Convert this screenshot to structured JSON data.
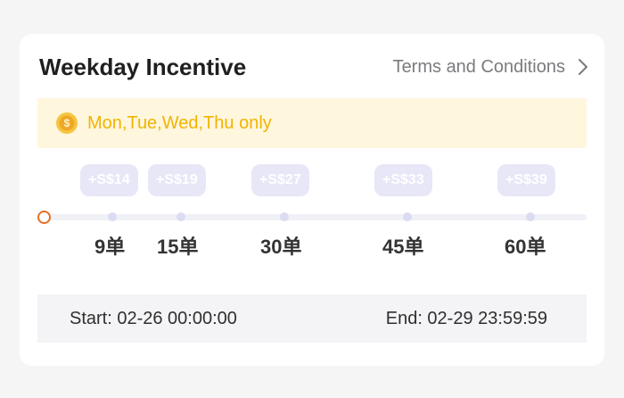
{
  "header": {
    "title": "Weekday Incentive",
    "terms_label": "Terms and Conditions",
    "icon": "chevron-right-icon"
  },
  "banner": {
    "icon": "coin-icon",
    "text": "Mon,Tue,Wed,Thu only"
  },
  "progress": {
    "current_orders": 0,
    "milestones": [
      {
        "reward": "+S$14",
        "orders": "9单"
      },
      {
        "reward": "+S$19",
        "orders": "15单"
      },
      {
        "reward": "+S$27",
        "orders": "30单"
      },
      {
        "reward": "+S$33",
        "orders": "45单"
      },
      {
        "reward": "+S$39",
        "orders": "60单"
      }
    ]
  },
  "schedule": {
    "start": "Start: 02-26 00:00:00",
    "end": "End: 02-29 23:59:59"
  },
  "colors": {
    "banner_bg": "#fff6de",
    "banner_text": "#f1b400",
    "badge_bg": "#e7e7f8",
    "progress_start": "#e46e24"
  }
}
